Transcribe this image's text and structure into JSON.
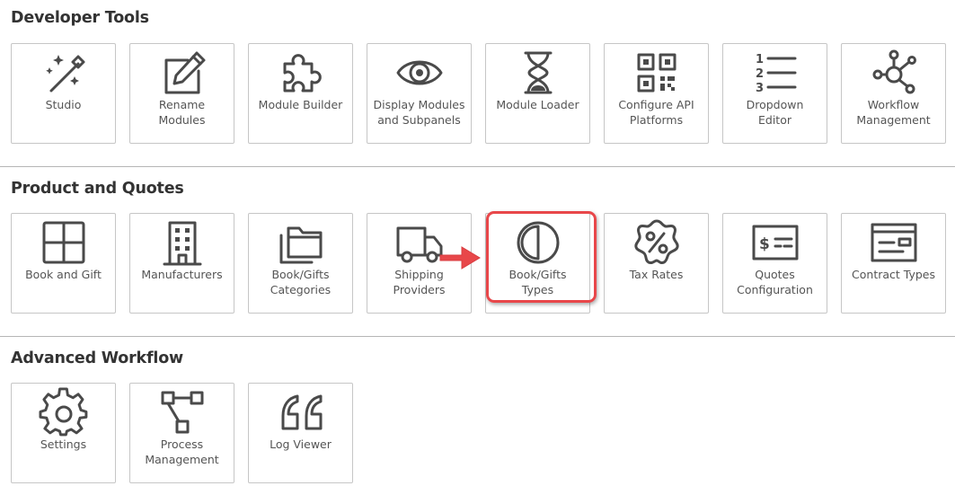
{
  "sections": [
    {
      "title": "Developer Tools",
      "tiles": [
        {
          "lines": [
            "Studio"
          ],
          "icon": "magic-wand-icon"
        },
        {
          "lines": [
            "Rename",
            "Modules"
          ],
          "icon": "edit-pencil-icon"
        },
        {
          "lines": [
            "Module Builder"
          ],
          "icon": "puzzle-piece-icon"
        },
        {
          "lines": [
            "Display Modules",
            "and Subpanels"
          ],
          "icon": "eye-icon"
        },
        {
          "lines": [
            "Module Loader"
          ],
          "icon": "hourglass-icon"
        },
        {
          "lines": [
            "Configure API",
            "Platforms"
          ],
          "icon": "qr-code-icon"
        },
        {
          "lines": [
            "Dropdown",
            "Editor"
          ],
          "icon": "numbered-list-icon"
        },
        {
          "lines": [
            "Workflow",
            "Management"
          ],
          "icon": "network-nodes-icon"
        }
      ]
    },
    {
      "title": "Product and Quotes",
      "tiles": [
        {
          "lines": [
            "Book and Gift"
          ],
          "icon": "grid-squares-icon"
        },
        {
          "lines": [
            "Manufacturers"
          ],
          "icon": "building-icon"
        },
        {
          "lines": [
            "Book/Gifts",
            "Categories"
          ],
          "icon": "folders-icon"
        },
        {
          "lines": [
            "Shipping",
            "Providers"
          ],
          "icon": "truck-icon"
        },
        {
          "lines": [
            "Book/Gifts",
            "Types"
          ],
          "icon": "half-circle-icon"
        },
        {
          "lines": [
            "Tax Rates"
          ],
          "icon": "percent-badge-icon"
        },
        {
          "lines": [
            "Quotes",
            "Configuration"
          ],
          "icon": "check-dollar-icon"
        },
        {
          "lines": [
            "Contract Types"
          ],
          "icon": "contract-form-icon"
        }
      ]
    },
    {
      "title": "Advanced Workflow",
      "tiles": [
        {
          "lines": [
            "Settings"
          ],
          "icon": "gear-icon"
        },
        {
          "lines": [
            "Process",
            "Management"
          ],
          "icon": "process-flow-icon"
        },
        {
          "lines": [
            "Log Viewer"
          ],
          "icon": "quote-marks-icon"
        }
      ]
    }
  ],
  "annotation": {
    "highlighted_tile": "Book/Gifts Types",
    "highlight_color": "#e8474a",
    "arrow_color": "#e8474a"
  },
  "colors": {
    "icon_stroke": "#4a4a4a",
    "tile_border": "#c6c6c6",
    "label_text": "#555555",
    "heading_text": "#333333"
  }
}
